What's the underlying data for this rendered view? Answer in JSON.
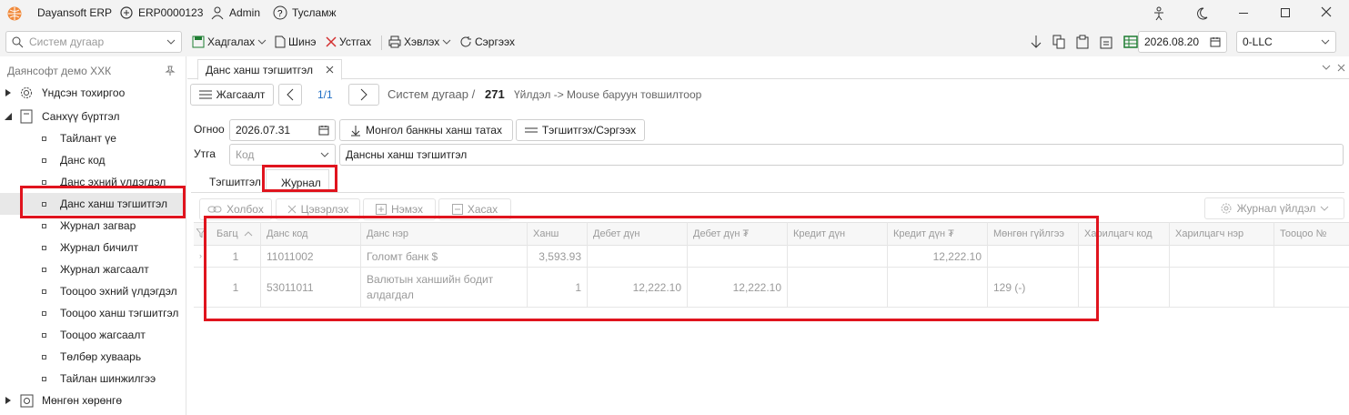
{
  "titlebar": {
    "app_name": "Dayansoft ERP",
    "db_name": "ERP0000123",
    "user": "Admin",
    "help": "Тусламж"
  },
  "toolbar": {
    "search_placeholder": "Систем дугаар",
    "save": "Хадгалах",
    "new": "Шинэ",
    "delete": "Устгах",
    "print": "Хэвлэх",
    "refresh": "Сэргээх",
    "date": "2026.08.20",
    "company": "0-LLC"
  },
  "sidebar": {
    "header": "Даянсофт демо ХХК",
    "items": [
      {
        "label": "Үндсэн тохиргоо"
      },
      {
        "label": "Санхүү бүртгэл"
      },
      {
        "label": "Тайлант үе"
      },
      {
        "label": "Данс код"
      },
      {
        "label": "Данс эхний үлдэгдэл"
      },
      {
        "label": "Данс ханш тэгшитгэл"
      },
      {
        "label": "Журнал загвар"
      },
      {
        "label": "Журнал бичилт"
      },
      {
        "label": "Журнал жагсаалт"
      },
      {
        "label": "Тооцоо эхний үлдэгдэл"
      },
      {
        "label": "Тооцоо ханш тэгшитгэл"
      },
      {
        "label": "Тооцоо жагсаалт"
      },
      {
        "label": "Төлбөр хуваарь"
      },
      {
        "label": "Тайлан шинжилгээ"
      },
      {
        "label": "Мөнгөн хөрөнгө"
      }
    ]
  },
  "doc_tab": {
    "label": "Данс ханш тэгшитгэл"
  },
  "nav": {
    "list_button": "Жагсаалт",
    "page": "1/1",
    "sys_label": "Систем дугаар /",
    "sys_number": "271",
    "hint": "Үйлдэл -> Mouse баруун товшилтоор"
  },
  "form": {
    "date_label": "Огноо",
    "date_value": "2026.07.31",
    "fetch_button": "Монгол банкны ханш татах",
    "equalize_button": "Тэгшитгэх/Сэргээх",
    "type_label": "Утга",
    "code_placeholder": "Код",
    "description": "Дансны ханш тэгшитгэл"
  },
  "subtabs": [
    "Тэгшитгэл",
    "Журнал"
  ],
  "grid_toolbar": {
    "link": "Холбох",
    "clear": "Цэвэрлэх",
    "add": "Нэмэх",
    "remove": "Хасах",
    "journal_action": "Журнал үйлдэл"
  },
  "grid": {
    "columns": [
      "Багц",
      "Данс код",
      "Данс нэр",
      "Ханш",
      "Дебет дүн",
      "Дебет дүн ₮",
      "Кредит дүн",
      "Кредит дүн ₮",
      "Мөнгөн гүйлгээ",
      "Харилцагч код",
      "Харилцагч нэр",
      "Тооцоо №"
    ],
    "rows": [
      {
        "batch": "1",
        "code": "11011002",
        "name": "Голомт банк $",
        "rate": "3,593.93",
        "debit": "",
        "debit_mnt": "",
        "credit": "",
        "credit_mnt": "12,222.10",
        "cash": "",
        "partner_code": "",
        "partner_name": "",
        "settlement": ""
      },
      {
        "batch": "1",
        "code": "53011011",
        "name": "Валютын ханшийн бодит алдагдал",
        "rate": "1",
        "debit": "12,222.10",
        "debit_mnt": "12,222.10",
        "credit": "",
        "credit_mnt": "",
        "cash": "129 (-)",
        "partner_code": "",
        "partner_name": "",
        "settlement": ""
      }
    ]
  },
  "colors": {
    "highlight": "#e0141e",
    "link": "#1f6fc5",
    "selected": "#e8e8e8"
  }
}
